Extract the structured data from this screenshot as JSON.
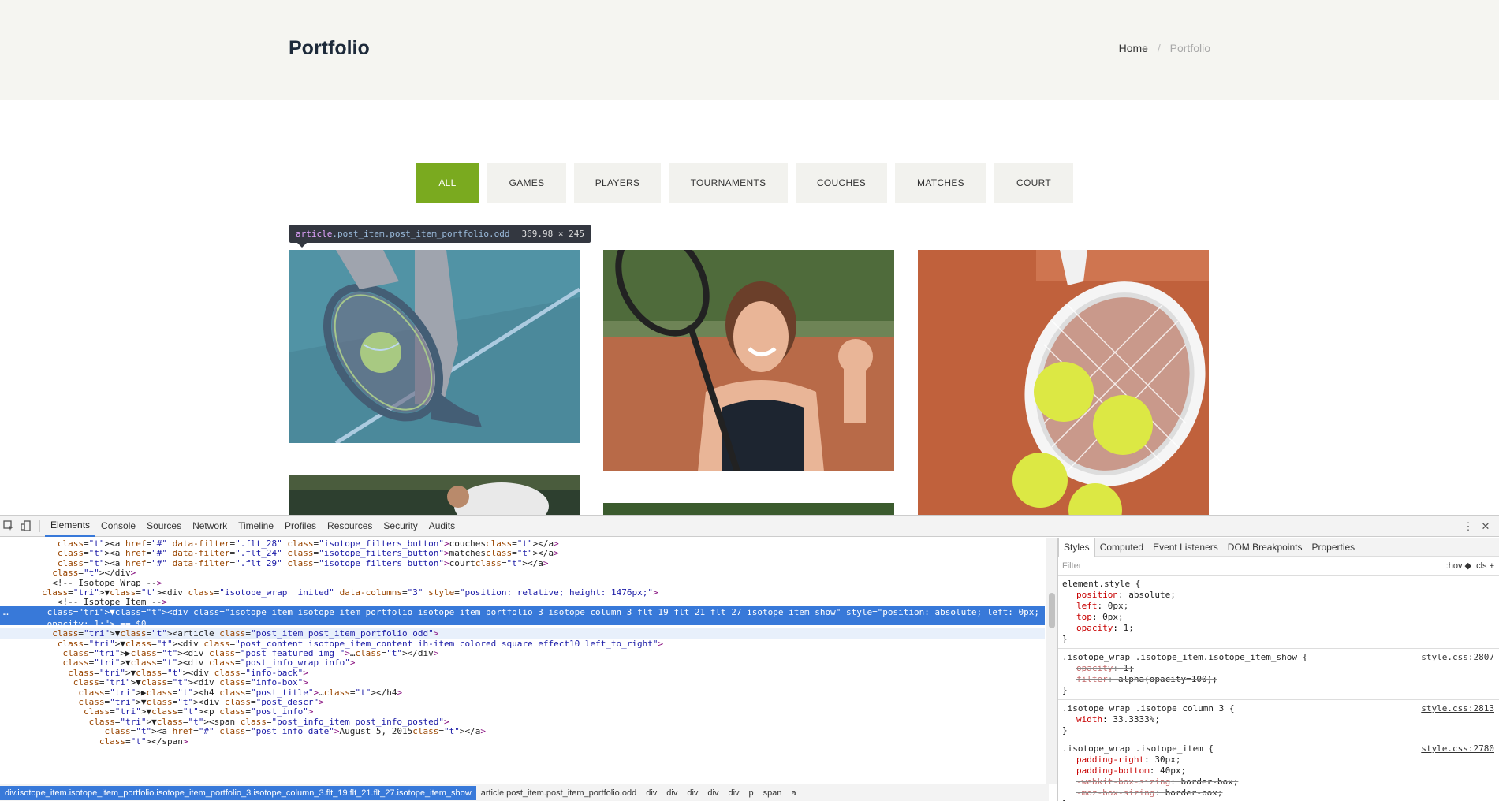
{
  "page": {
    "title": "Portfolio",
    "breadcrumb": {
      "home": "Home",
      "separator": "/",
      "current": "Portfolio"
    },
    "filters": [
      "ALL",
      "GAMES",
      "PLAYERS",
      "TOURNAMENTS",
      "COUCHES",
      "MATCHES",
      "COURT"
    ],
    "active_filter": "ALL",
    "inspector_tooltip": {
      "tag": "article",
      "classes": ".post_item.post_item_portfolio.odd",
      "dims": "369.98 × 245"
    }
  },
  "colors": {
    "accent": "#7aaa1f",
    "header_bg": "#f5f5f1",
    "filter_bg": "#f2f2ee",
    "devtools_select": "#3879d9"
  },
  "devtools": {
    "tabs": [
      "Elements",
      "Console",
      "Sources",
      "Network",
      "Timeline",
      "Profiles",
      "Resources",
      "Security",
      "Audits"
    ],
    "active_tab": "Elements",
    "dom_lines": [
      {
        "indent": 11,
        "text": "<a href=\"#\" data-filter=\".flt_28\" class=\"isotope_filters_button\">couches</a>"
      },
      {
        "indent": 11,
        "text": "<a href=\"#\" data-filter=\".flt_24\" class=\"isotope_filters_button\">matches</a>"
      },
      {
        "indent": 11,
        "text": "<a href=\"#\" data-filter=\".flt_29\" class=\"isotope_filters_button\">court</a>"
      },
      {
        "indent": 10,
        "text": "</div>"
      },
      {
        "indent": 10,
        "text": "<!-- Isotope Wrap -->"
      },
      {
        "indent": 9,
        "text": "▼<div class=\"isotope_wrap  inited\" data-columns=\"3\" style=\"position: relative; height: 1476px;\">"
      },
      {
        "indent": 11,
        "text": "<!-- Isotope Item -->"
      },
      {
        "indent": 10,
        "text": "▼<div class=\"isotope_item isotope_item_portfolio isotope_item_portfolio_3 isotope_column_3 flt_19 flt_21 flt_27 isotope_item_show\" style=\"position: absolute; left: 0px; top: 0px;"
      },
      {
        "indent": 10,
        "text": "opacity: 1;\"> == $0"
      },
      {
        "indent": 11,
        "text": "▼<article class=\"post_item post_item_portfolio odd\">"
      },
      {
        "indent": 12,
        "text": "▼<div class=\"post_content isotope_item_content ih-item colored square effect10 left_to_right\">"
      },
      {
        "indent": 13,
        "text": "▶<div class=\"post_featured img \">…</div>"
      },
      {
        "indent": 13,
        "text": "▼<div class=\"post_info_wrap info\">"
      },
      {
        "indent": 14,
        "text": "▼<div class=\"info-back\">"
      },
      {
        "indent": 15,
        "text": "▼<div class=\"info-box\">"
      },
      {
        "indent": 16,
        "text": "▶<h4 class=\"post_title\">…</h4>"
      },
      {
        "indent": 16,
        "text": "▼<div class=\"post_descr\">"
      },
      {
        "indent": 17,
        "text": "▼<p class=\"post_info\">"
      },
      {
        "indent": 18,
        "text": "▼<span class=\"post_info_item post_info_posted\">"
      },
      {
        "indent": 20,
        "text": "<a href=\"#\" class=\"post_info_date\">August 5, 2015</a>"
      },
      {
        "indent": 19,
        "text": "</span>"
      }
    ],
    "styles_tabs": [
      "Styles",
      "Computed",
      "Event Listeners",
      "DOM Breakpoints",
      "Properties"
    ],
    "styles_filter_placeholder": "Filter",
    "styles_tools": ":hov  ◆  .cls  +",
    "rules": [
      {
        "selector": "element.style {",
        "source": "",
        "props": [
          {
            "name": "position",
            "value": "absolute;",
            "struck": false
          },
          {
            "name": "left",
            "value": "0px;",
            "struck": false
          },
          {
            "name": "top",
            "value": "0px;",
            "struck": false
          },
          {
            "name": "opacity",
            "value": "1;",
            "struck": false
          }
        ]
      },
      {
        "selector": ".isotope_wrap .isotope_item.isotope_item_show {",
        "source": "style.css:2807",
        "props": [
          {
            "name": "opacity",
            "value": "1;",
            "struck": true
          },
          {
            "name": "filter",
            "value": "alpha(opacity=100);",
            "struck": true
          }
        ]
      },
      {
        "selector": ".isotope_wrap .isotope_column_3 {",
        "source": "style.css:2813",
        "props": [
          {
            "name": "width",
            "value": "33.3333%;",
            "struck": false
          }
        ]
      },
      {
        "selector": ".isotope_wrap .isotope_item {",
        "source": "style.css:2780",
        "props": [
          {
            "name": "padding-right",
            "value": "30px;",
            "struck": false
          },
          {
            "name": "padding-bottom",
            "value": "40px;",
            "struck": false
          },
          {
            "name": "-webkit-box-sizing",
            "value": "border-box;",
            "struck": true
          },
          {
            "name": "-moz-box-sizing",
            "value": "border-box;",
            "struck": true
          }
        ]
      }
    ],
    "crumbs": [
      "div.isotope_item.isotope_item_portfolio.isotope_item_portfolio_3.isotope_column_3.flt_19.flt_21.flt_27.isotope_item_show",
      "article.post_item.post_item_portfolio.odd",
      "div",
      "div",
      "div",
      "div",
      "div",
      "p",
      "span",
      "a"
    ]
  }
}
